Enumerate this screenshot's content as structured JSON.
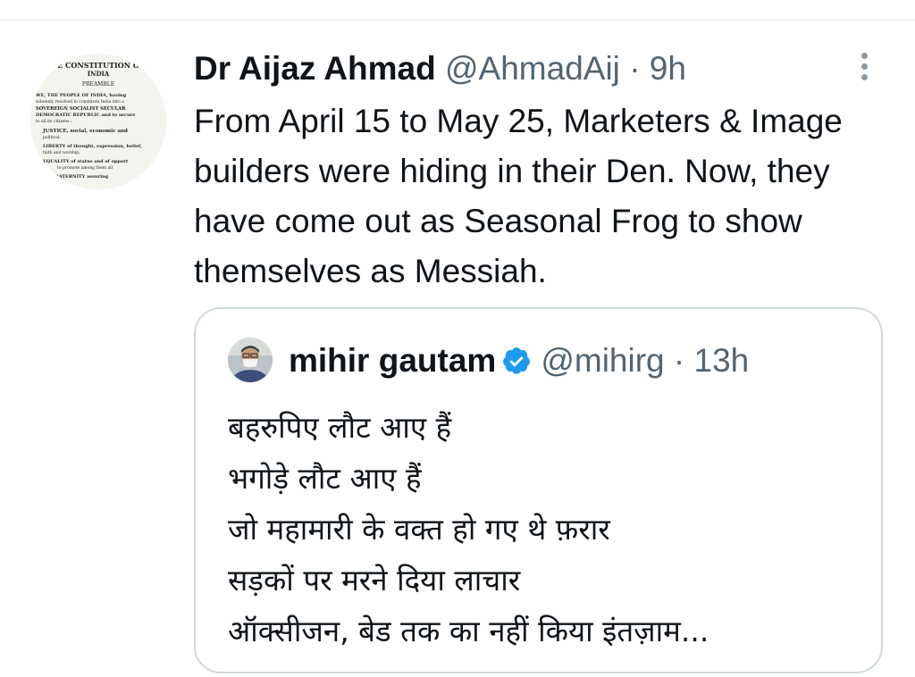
{
  "tweet": {
    "author_name": "Dr Aijaz Ahmad",
    "handle": "@AhmadAij",
    "separator": "·",
    "time": "9h",
    "text": "From April 15 to May 25, Marketers & Image builders were hiding in their Den. Now, they have come out as Seasonal Frog to show themselves as Messiah.",
    "avatar_lines": [
      "E CONSTITUTION O",
      "INDIA",
      "PREAMBLE",
      "WE, THE PEOPLE OF INDIA, having",
      "solemnly resolved to constitute India into a",
      "SOVEREIGN SOCIALIST SECULAR",
      "DEMOCRATIC REPUBLIC and to secure",
      "to all its citizens :",
      "JUSTICE, social, economic and",
      "political;",
      "LIBERTY of thought, expression, belief,",
      "faith and worship;",
      "EQUALITY of status and of opport",
      "to promote among them all",
      "FRATERNITY assuring"
    ]
  },
  "quote": {
    "author_name": "mihir gautam",
    "handle": "@mihirg",
    "separator": "·",
    "time": "13h",
    "lines": [
      "बहरुपिए लौट आए हैं",
      "भगोड़े लौट आए हैं",
      "जो महामारी के वक्त हो गए थे फ़रार",
      "सड़कों पर मरने दिया लाचार",
      "ऑक्सीजन, बेड तक का नहीं किया इंतज़ाम..."
    ]
  },
  "icons": {
    "more": "more-vertical-icon",
    "verified": "verified-badge-icon"
  },
  "colors": {
    "text_primary": "#0f1419",
    "text_secondary": "#536471",
    "verified_blue": "#1d9bf0",
    "card_border": "#cfd9de"
  }
}
